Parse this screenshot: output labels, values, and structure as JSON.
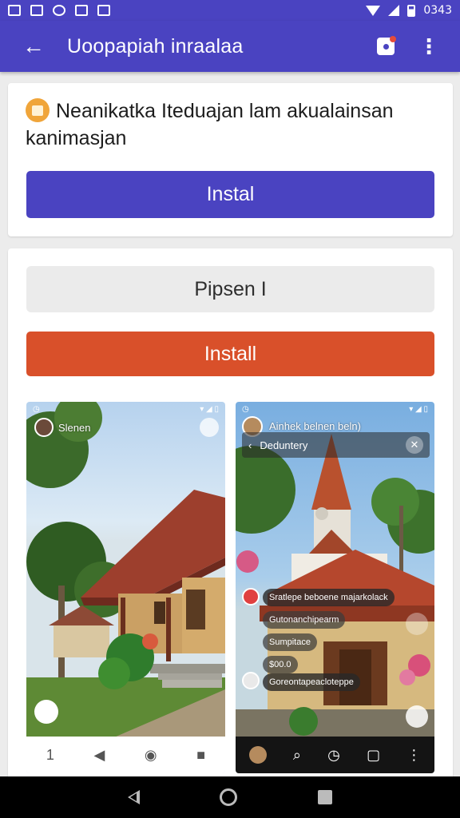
{
  "status_bar": {
    "time": "0343",
    "icons": [
      "notification-a-icon",
      "notification-x-icon",
      "notification-cloud-icon",
      "notification-n-icon",
      "notification-box-icon",
      "wifi-icon",
      "signal-icon",
      "battery-icon"
    ]
  },
  "app_bar": {
    "title": "Uoopapiah inraalaa",
    "back_icon": "arrow-left-icon",
    "actions": [
      "app-icon",
      "more-vert-icon"
    ],
    "color": "#4a43c1"
  },
  "notice_card": {
    "icon": "app-box-icon",
    "text": "Neanikatka Iteduajan lam akualainsan kanimasjan",
    "install_label": "Instal",
    "install_color": "#4a43c1"
  },
  "options_card": {
    "secondary_label": "Pipsen I",
    "install_label": "Install",
    "install_color": "#d9502a",
    "screenshots": [
      {
        "label": "Slenen",
        "nav": [
          "1",
          "◀",
          "◉",
          "■"
        ]
      },
      {
        "title": "Ainhek belnen beln)",
        "header": "Deduntery",
        "comments": [
          "Sratlepe beboene majarkolack",
          "Gutonanchipearm",
          "Sumpitace",
          "$00.0",
          "Goreontapeacloteppe"
        ],
        "nav": [
          "⌕",
          "◷",
          "▢",
          "⋮"
        ]
      }
    ]
  },
  "system_nav": [
    "back-icon",
    "home-icon",
    "recents-icon"
  ]
}
